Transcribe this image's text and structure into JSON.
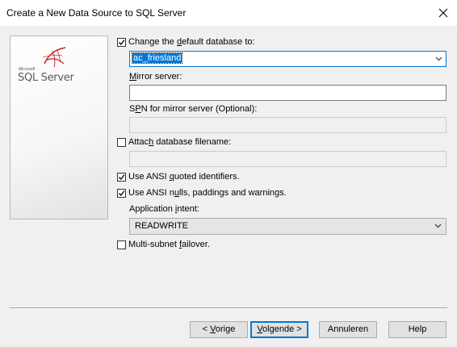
{
  "window": {
    "title": "Create a New Data Source to SQL Server"
  },
  "logo": {
    "brand_small": "Microsoft",
    "brand_name": "SQL Server"
  },
  "options": {
    "change_default_db": {
      "checked": true,
      "label_pre": "Change the ",
      "label_key": "d",
      "label_post": "efault database to:"
    },
    "database_combo": {
      "value": "ac_friesland"
    },
    "mirror_server": {
      "label_key": "M",
      "label_post": "irror server:",
      "value": ""
    },
    "spn_mirror": {
      "label_pre": "S",
      "label_key": "P",
      "label_post": "N for mirror server (Optional):",
      "value": ""
    },
    "attach_db": {
      "checked": false,
      "label_pre": "Attac",
      "label_key": "h",
      "label_post": " database filename:",
      "value": ""
    },
    "ansi_quoted": {
      "checked": true,
      "label_pre": "Use ANSI ",
      "label_key": "q",
      "label_post": "uoted identifiers."
    },
    "ansi_nulls": {
      "checked": true,
      "label_pre": "Use ANSI n",
      "label_key": "u",
      "label_post": "lls, paddings and warnings."
    },
    "app_intent": {
      "label_pre": "Application ",
      "label_key": "i",
      "label_post": "ntent:",
      "value": "READWRITE"
    },
    "multi_subnet": {
      "checked": false,
      "label_pre": "Multi-subnet ",
      "label_key": "f",
      "label_post": "ailover."
    }
  },
  "buttons": {
    "back": {
      "pre": "< ",
      "key": "V",
      "post": "orige"
    },
    "next": {
      "pre": "",
      "key": "V",
      "post": "olgende >"
    },
    "cancel": {
      "label": "Annuleren"
    },
    "help": {
      "label": "Help"
    }
  }
}
